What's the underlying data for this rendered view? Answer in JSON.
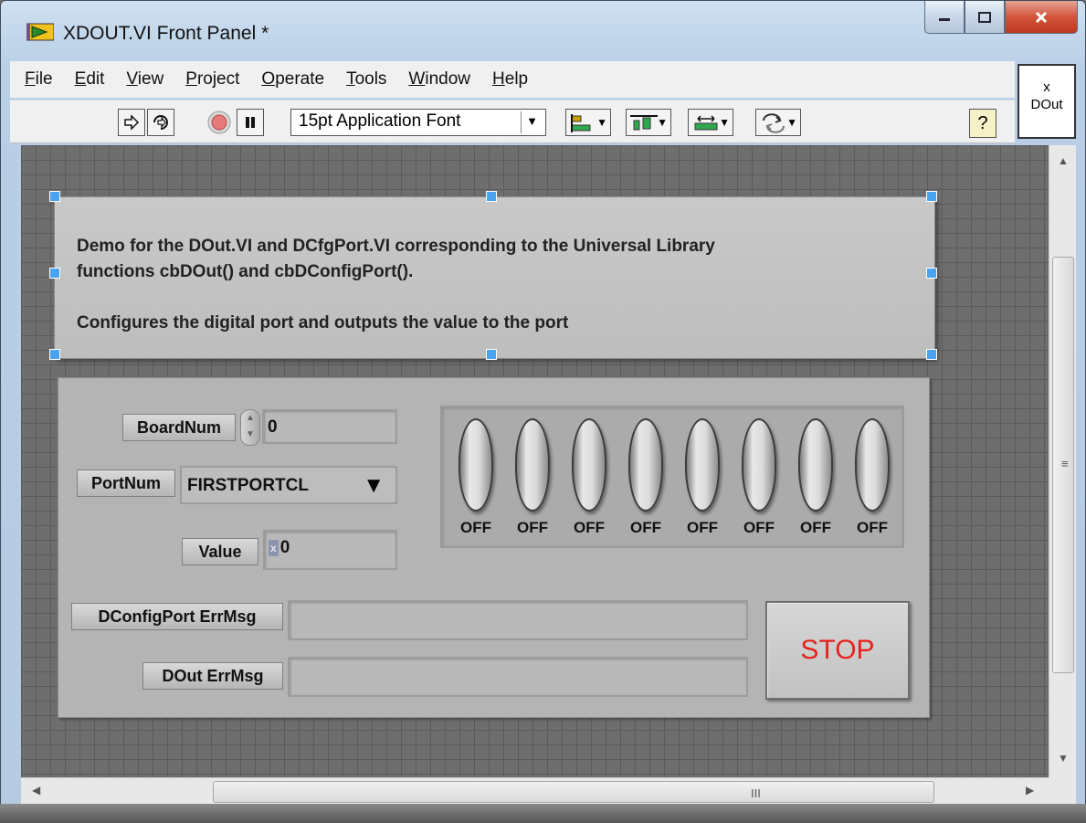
{
  "window": {
    "title": "XDOUT.VI Front Panel *"
  },
  "menu": {
    "items": [
      {
        "key": "F",
        "rest": "ile"
      },
      {
        "key": "E",
        "rest": "dit"
      },
      {
        "key": "V",
        "rest": "iew"
      },
      {
        "key": "P",
        "rest": "roject"
      },
      {
        "key": "O",
        "rest": "perate"
      },
      {
        "key": "T",
        "rest": "ools"
      },
      {
        "key": "W",
        "rest": "indow"
      },
      {
        "key": "H",
        "rest": "elp"
      }
    ]
  },
  "toolbar": {
    "font": "15pt Application Font",
    "help": "?"
  },
  "vi_icon": {
    "line1": "x",
    "line2": "DOut"
  },
  "description": {
    "line1": "Demo for the DOut.VI and DCfgPort.VI corresponding to the Universal Library",
    "line2": "functions  cbDOut() and cbDConfigPort().",
    "line3": "Configures the digital port and outputs the value to the port"
  },
  "controls": {
    "boardnum_label": "BoardNum",
    "boardnum_value": "0",
    "portnum_label": "PortNum",
    "portnum_value": "FIRSTPORTCL",
    "value_label": "Value",
    "value_radix": "x",
    "value_value": "0",
    "dconfig_err_label": "DConfigPort ErrMsg",
    "dconfig_err_value": "",
    "dout_err_label": "DOut ErrMsg",
    "dout_err_value": "",
    "stop_label": "STOP"
  },
  "leds": [
    {
      "label": "OFF",
      "state": false
    },
    {
      "label": "OFF",
      "state": false
    },
    {
      "label": "OFF",
      "state": false
    },
    {
      "label": "OFF",
      "state": false
    },
    {
      "label": "OFF",
      "state": false
    },
    {
      "label": "OFF",
      "state": false
    },
    {
      "label": "OFF",
      "state": false
    },
    {
      "label": "OFF",
      "state": false
    }
  ],
  "scrollbars": {
    "grip": "III",
    "vgrip": "≡"
  }
}
